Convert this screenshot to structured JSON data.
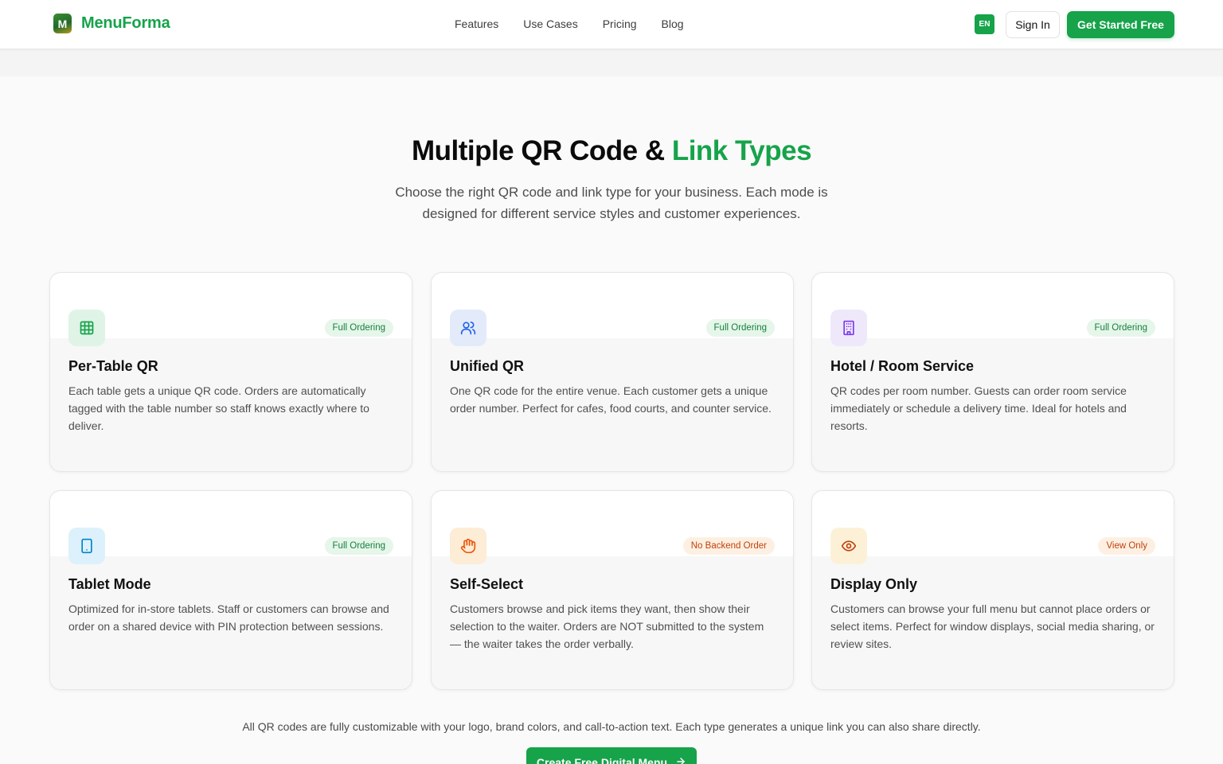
{
  "header": {
    "brand": "MenuForma",
    "logo_letter": "M",
    "nav": [
      "Features",
      "Use Cases",
      "Pricing",
      "Blog"
    ],
    "lang": "EN",
    "sign_in": "Sign In",
    "get_started": "Get Started Free"
  },
  "hero": {
    "title_main": "Multiple QR Code & ",
    "title_accent": "Link Types",
    "subtitle": "Choose the right QR code and link type for your business. Each mode is designed for different service styles and customer experiences."
  },
  "cards": [
    {
      "title": "Per-Table QR",
      "badge": "Full Ordering",
      "badge_tone": "green",
      "icon": "table-grid-icon",
      "icon_bg": "#dff4e6",
      "icon_color": "#16a34a",
      "desc": "Each table gets a unique QR code. Orders are automatically tagged with the table number so staff knows exactly where to deliver."
    },
    {
      "title": "Unified QR",
      "badge": "Full Ordering",
      "badge_tone": "green",
      "icon": "users-icon",
      "icon_bg": "#e3ebfb",
      "icon_color": "#2563eb",
      "desc": "One QR code for the entire venue. Each customer gets a unique order number. Perfect for cafes, food courts, and counter service."
    },
    {
      "title": "Hotel / Room Service",
      "badge": "Full Ordering",
      "badge_tone": "green",
      "icon": "building-icon",
      "icon_bg": "#efe8fb",
      "icon_color": "#7c3aed",
      "desc": "QR codes per room number. Guests can order room service immediately or schedule a delivery time. Ideal for hotels and resorts."
    },
    {
      "title": "Tablet Mode",
      "badge": "Full Ordering",
      "badge_tone": "green",
      "icon": "tablet-icon",
      "icon_bg": "#dcf1fb",
      "icon_color": "#0284c7",
      "desc": "Optimized for in-store tablets. Staff or customers can browse and order on a shared device with PIN protection between sessions."
    },
    {
      "title": "Self-Select",
      "badge": "No Backend Order",
      "badge_tone": "orange",
      "icon": "hand-icon",
      "icon_bg": "#fdecd6",
      "icon_color": "#ea580c",
      "desc": "Customers browse and pick items they want, then show their selection to the waiter. Orders are NOT submitted to the system — the waiter takes the order verbally."
    },
    {
      "title": "Display Only",
      "badge": "View Only",
      "badge_tone": "orange",
      "icon": "eye-icon",
      "icon_bg": "#fcf1d7",
      "icon_color": "#c2410c",
      "desc": "Customers can browse your full menu but cannot place orders or select items. Perfect for window displays, social media sharing, or review sites."
    }
  ],
  "footer_note": "All QR codes are fully customizable with your logo, brand colors, and call-to-action text. Each type generates a unique link you can also share directly.",
  "cta": "Create Free Digital Menu"
}
